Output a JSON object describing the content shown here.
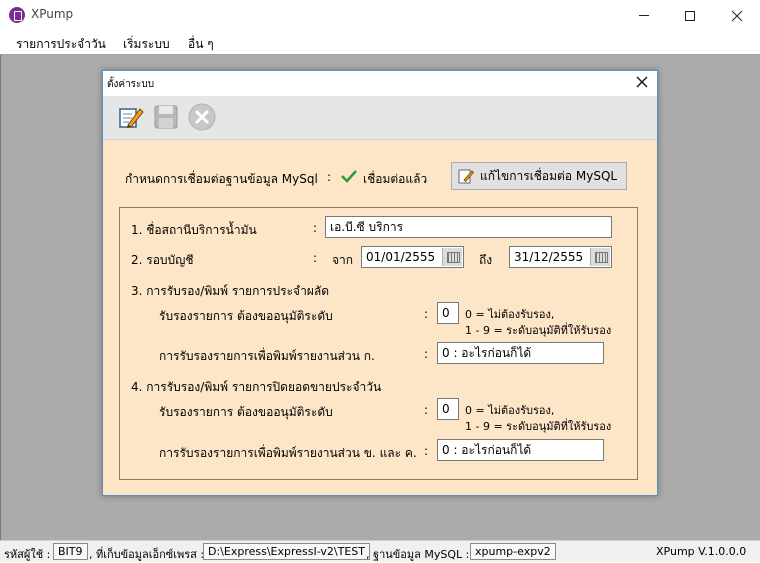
{
  "window": {
    "title": "XPump"
  },
  "menu": {
    "items": [
      "รายการประจำวัน",
      "เริ่มระบบ",
      "อื่น ๆ"
    ]
  },
  "dialog": {
    "title": "ตั้งค่าระบบ",
    "mysql_label": "กำหนดการเชื่อมต่อฐานข้อมูล MySql",
    "colon": ":",
    "connected_text": "เชื่อมต่อแล้ว",
    "edit_connection_button": "แก้ไขการเชื่อมต่อ MySQL",
    "section1_label": "1. ชื่อสถานีบริการน้ำมัน",
    "section1_value": "เอ.บี.ซี บริการ",
    "section2_label": "2. รอบบัญชี",
    "from_label": "จาก",
    "from_date": "01/01/2555",
    "to_label": "ถึง",
    "to_date": "31/12/2555",
    "section3_title": "3. การรับรอง/พิมพ์ รายการประจำผลัด",
    "section3_approve_label": "รับรองรายการ ต้องขออนุมัติระดับ",
    "section3_approve_value": "0",
    "section3_hint1": "0 = ไม่ต้องรับรอง,",
    "section3_hint2": "1 - 9 = ระดับอนุมัติที่ให้รับรอง",
    "section3_print_label": "การรับรองรายการเพื่อพิมพ์รายงานส่วน ก.",
    "section3_print_value": "0 : อะไรก่อนก็ได้",
    "section4_title": "4. การรับรอง/พิมพ์ รายการปิดยอดขายประจำวัน",
    "section4_approve_label": "รับรองรายการ ต้องขออนุมัติระดับ",
    "section4_approve_value": "0",
    "section4_hint1": "0 = ไม่ต้องรับรอง,",
    "section4_hint2": "1 - 9 = ระดับอนุมัติที่ให้รับรอง",
    "section4_print_label": "การรับรองรายการเพื่อพิมพ์รายงานส่วน ข. และ ค.",
    "section4_print_value": "0 : อะไรก่อนก็ได้"
  },
  "statusbar": {
    "user_label": "รหัสผู้ใช้ :",
    "user_value": "BIT9",
    "path_label": ", ที่เก็บข้อมูลเอ็กซ์เพรส :",
    "path_value": "D:\\Express\\ExpressI-v2\\TEST",
    "db_label": ", ฐานข้อมูล MySQL :",
    "db_value": "xpump-expv2",
    "version": "XPump V.1.0.0.0"
  },
  "colors": {
    "dialog_bg": "#fde5c8",
    "mdi_bg": "#ababab",
    "check_green": "#2e9b3a"
  }
}
